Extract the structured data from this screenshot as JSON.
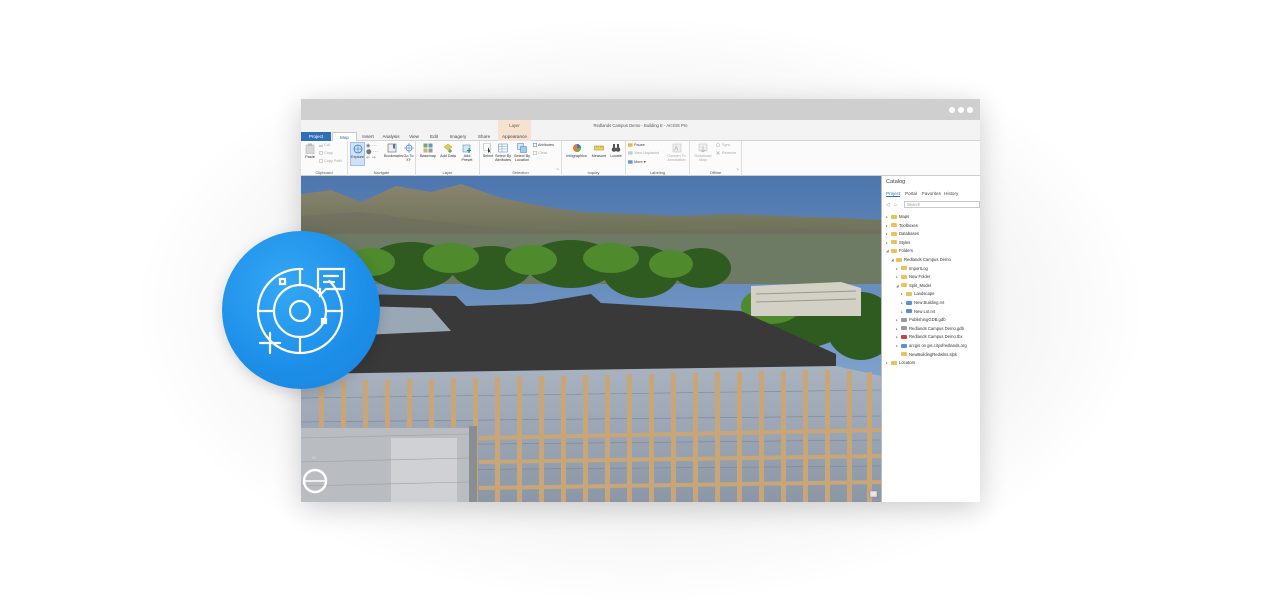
{
  "window": {
    "title": "Redlands Campus Demo - Building E - ArcGIS Pro",
    "context_tab_group": "Layer"
  },
  "tabs": [
    "Project",
    "Map",
    "Insert",
    "Analysis",
    "View",
    "Edit",
    "Imagery",
    "Share",
    "Appearance"
  ],
  "ribbon": {
    "clipboard": {
      "label": "Clipboard",
      "paste": "Paste",
      "cut": "Cut",
      "copy": "Copy",
      "copy_path": "Copy Path"
    },
    "navigate": {
      "label": "Navigate",
      "explore": "Explore",
      "bookmarks": "Bookmarks",
      "go_to_xy": "Go To XY"
    },
    "layer": {
      "label": "Layer",
      "basemap": "Basemap",
      "add_data": "Add Data",
      "add_preset": "Add Preset"
    },
    "selection": {
      "label": "Selection",
      "select": "Select",
      "select_by_attributes": "Select By Attributes",
      "select_by_location": "Select By Location",
      "attributes": "Attributes",
      "clear": "Clear"
    },
    "inquiry": {
      "label": "Inquiry",
      "infographics": "Infographics",
      "measure": "Measure",
      "locate": "Locate"
    },
    "labeling": {
      "label": "Labeling",
      "pause": "Pause",
      "view_unplaced": "View Unplaced",
      "more": "More",
      "convert_to_annotation": "Convert To Annotation"
    },
    "offline": {
      "label": "Offline",
      "download_map": "Download Map",
      "sync": "Sync",
      "remove": "Remove"
    }
  },
  "catalog": {
    "title": "Catalog",
    "tabs": [
      "Project",
      "Portal",
      "Favorites",
      "History"
    ],
    "search_placeholder": "Search",
    "items": [
      {
        "label": "Maps",
        "depth": 0,
        "caret": "▸",
        "icon": "fold"
      },
      {
        "label": "Toolboxes",
        "depth": 0,
        "caret": "▸",
        "icon": "fold"
      },
      {
        "label": "Databases",
        "depth": 0,
        "caret": "▸",
        "icon": "fold"
      },
      {
        "label": "Styles",
        "depth": 0,
        "caret": "▸",
        "icon": "fold"
      },
      {
        "label": "Folders",
        "depth": 0,
        "caret": "◢",
        "icon": "fold"
      },
      {
        "label": "Redlands Campus Demo",
        "depth": 1,
        "caret": "◢",
        "icon": "fold"
      },
      {
        "label": "ImportLog",
        "depth": 2,
        "caret": "▸",
        "icon": "fold"
      },
      {
        "label": "New Folder",
        "depth": 2,
        "caret": "▸",
        "icon": "fold"
      },
      {
        "label": "Split_Model",
        "depth": 2,
        "caret": "◢",
        "icon": "fold"
      },
      {
        "label": "Landscape",
        "depth": 3,
        "caret": "▸",
        "icon": "fold"
      },
      {
        "label": "New Building.rvt",
        "depth": 3,
        "caret": "▸",
        "icon": "blue"
      },
      {
        "label": "New Lot.rvt",
        "depth": 3,
        "caret": "▸",
        "icon": "blue"
      },
      {
        "label": "PublishingGDB.gdb",
        "depth": 2,
        "caret": "▸",
        "icon": "grey"
      },
      {
        "label": "Redlands Campus Demo.gdb",
        "depth": 2,
        "caret": "▸",
        "icon": "grey"
      },
      {
        "label": "Redlands Campus Demo.tbx",
        "depth": 2,
        "caret": "▸",
        "icon": "red"
      },
      {
        "label": "arcgis on gis.cityofredlands.org",
        "depth": 2,
        "caret": "▸",
        "icon": "blue"
      },
      {
        "label": "NewBuildingRedwlns.slpk",
        "depth": 2,
        "caret": "",
        "icon": "fold"
      },
      {
        "label": "Locators",
        "depth": 0,
        "caret": "▸",
        "icon": "fold"
      }
    ]
  },
  "colors": {
    "accent": "#2f6fb7",
    "badge": "#1c8ee8",
    "context_tab": "#f5e3cf"
  }
}
